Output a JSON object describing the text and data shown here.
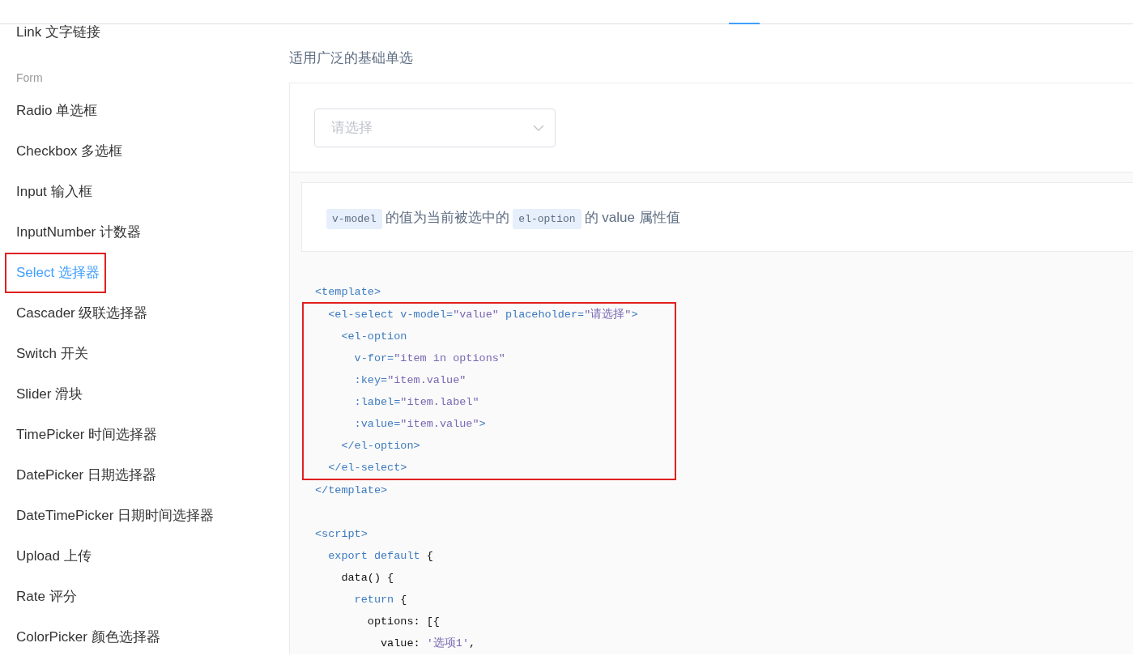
{
  "sidebar": {
    "items": [
      {
        "kind": "item",
        "label": "Link 文字链接",
        "selected": false,
        "highlighted": false
      },
      {
        "kind": "group",
        "label": "Form"
      },
      {
        "kind": "item",
        "label": "Radio 单选框",
        "selected": false,
        "highlighted": false
      },
      {
        "kind": "item",
        "label": "Checkbox 多选框",
        "selected": false,
        "highlighted": false
      },
      {
        "kind": "item",
        "label": "Input 输入框",
        "selected": false,
        "highlighted": false
      },
      {
        "kind": "item",
        "label": "InputNumber 计数器",
        "selected": false,
        "highlighted": false
      },
      {
        "kind": "item",
        "label": "Select 选择器",
        "selected": true,
        "highlighted": true
      },
      {
        "kind": "item",
        "label": "Cascader 级联选择器",
        "selected": false,
        "highlighted": false
      },
      {
        "kind": "item",
        "label": "Switch 开关",
        "selected": false,
        "highlighted": false
      },
      {
        "kind": "item",
        "label": "Slider 滑块",
        "selected": false,
        "highlighted": false
      },
      {
        "kind": "item",
        "label": "TimePicker 时间选择器",
        "selected": false,
        "highlighted": false
      },
      {
        "kind": "item",
        "label": "DatePicker 日期选择器",
        "selected": false,
        "highlighted": false
      },
      {
        "kind": "item",
        "label": "DateTimePicker 日期时间选择器",
        "selected": false,
        "highlighted": false
      },
      {
        "kind": "item",
        "label": "Upload 上传",
        "selected": false,
        "highlighted": false
      },
      {
        "kind": "item",
        "label": "Rate 评分",
        "selected": false,
        "highlighted": false
      },
      {
        "kind": "item",
        "label": "ColorPicker 颜色选择器",
        "selected": false,
        "highlighted": false
      }
    ]
  },
  "main": {
    "description": "适用广泛的基础单选",
    "demo": {
      "select": {
        "placeholder": "请选择"
      }
    },
    "note": [
      {
        "kind": "code",
        "text": "v-model"
      },
      {
        "kind": "text",
        "text": "的值为当前被选中的"
      },
      {
        "kind": "code",
        "text": "el-option"
      },
      {
        "kind": "text",
        "text": "的 value 属性值"
      }
    ],
    "code_blocks": [
      {
        "highlighted": false,
        "lines": [
          [
            {
              "kind": "tag",
              "text": "<template>"
            }
          ]
        ]
      },
      {
        "highlighted": true,
        "lines": [
          [
            {
              "kind": "tag",
              "text": "  <el-select "
            },
            {
              "kind": "attr",
              "text": "v-model="
            },
            {
              "kind": "string",
              "text": "\"value\""
            },
            {
              "kind": "attr",
              "text": " placeholder="
            },
            {
              "kind": "string",
              "text": "\"请选择\""
            },
            {
              "kind": "tag",
              "text": ">"
            }
          ],
          [
            {
              "kind": "tag",
              "text": "    <el-option"
            }
          ],
          [
            {
              "kind": "attr",
              "text": "      v-for="
            },
            {
              "kind": "string",
              "text": "\"item in options\""
            }
          ],
          [
            {
              "kind": "attr",
              "text": "      :key="
            },
            {
              "kind": "string",
              "text": "\"item.value\""
            }
          ],
          [
            {
              "kind": "attr",
              "text": "      :label="
            },
            {
              "kind": "string",
              "text": "\"item.label\""
            }
          ],
          [
            {
              "kind": "attr",
              "text": "      :value="
            },
            {
              "kind": "string",
              "text": "\"item.value\""
            },
            {
              "kind": "tag",
              "text": ">"
            }
          ],
          [
            {
              "kind": "tag",
              "text": "    </el-option>"
            }
          ],
          [
            {
              "kind": "tag",
              "text": "  </el-select>"
            }
          ]
        ]
      },
      {
        "highlighted": false,
        "lines": [
          [
            {
              "kind": "tag",
              "text": "</template>"
            }
          ]
        ]
      },
      {
        "highlighted": false,
        "blank_line_before": true,
        "lines": [
          [
            {
              "kind": "tag",
              "text": "<script>"
            }
          ],
          [
            {
              "kind": "keyword",
              "text": "  export default"
            },
            {
              "kind": "plain",
              "text": " {"
            }
          ],
          [
            {
              "kind": "plain",
              "text": "    data() {"
            }
          ],
          [
            {
              "kind": "keyword",
              "text": "      return"
            },
            {
              "kind": "plain",
              "text": " {"
            }
          ],
          [
            {
              "kind": "plain",
              "text": "        options: [{"
            }
          ],
          [
            {
              "kind": "plain",
              "text": "          value: "
            },
            {
              "kind": "string",
              "text": "'选项1'"
            },
            {
              "kind": "plain",
              "text": ","
            }
          ]
        ]
      }
    ]
  }
}
